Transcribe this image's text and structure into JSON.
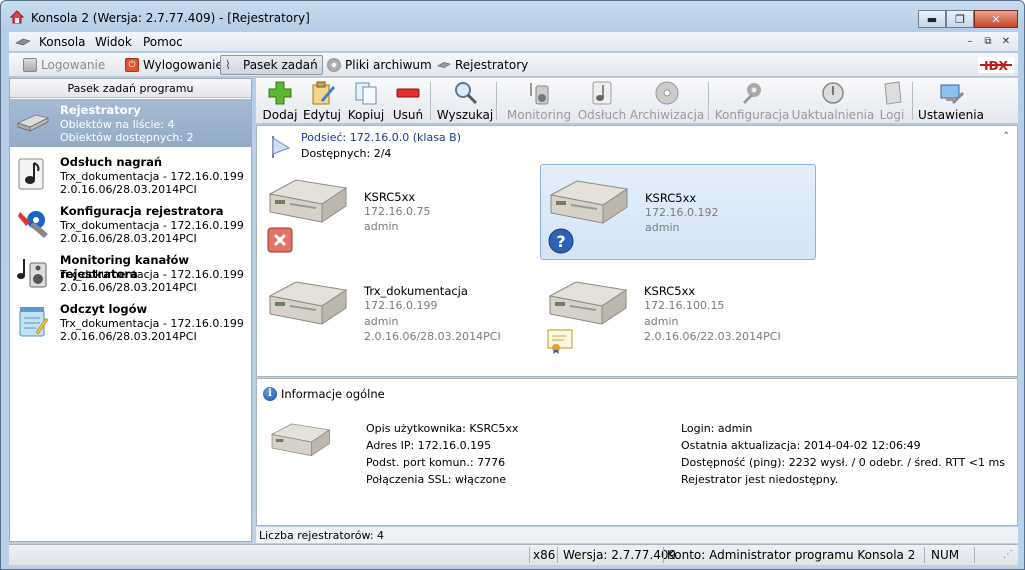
{
  "window": {
    "title": "Konsola 2 (Wersja:  2.7.77.409) - [Rejestratory]",
    "minimize": "▬",
    "maximize": "❐",
    "close": "✕"
  },
  "menu": {
    "items": [
      "Konsola",
      "Widok",
      "Pomoc"
    ],
    "mdi": [
      "–",
      "⧉",
      "✕"
    ]
  },
  "taskbar": {
    "items": [
      {
        "label": "Logowanie",
        "state": "disabled"
      },
      {
        "label": "Wylogowanie",
        "state": "normal"
      },
      {
        "label": "Pasek zadań",
        "state": "active"
      },
      {
        "label": "Pliki archiwum",
        "state": "normal"
      },
      {
        "label": "Rejestratory",
        "state": "normal"
      }
    ]
  },
  "sidebar": {
    "header": "Pasek zadań programu",
    "items": [
      {
        "title": "Rejestratory",
        "line1": "Obiektów na liście: 4",
        "line2": "Obiektów dostępnych: 2",
        "selected": true,
        "icon": "recorder-icon"
      },
      {
        "title": "Odsłuch nagrań",
        "line1": "Trx_dokumentacja - 172.16.0.199",
        "line2": "2.0.16.06/28.03.2014PCI",
        "icon": "music-note-icon"
      },
      {
        "title": "Konfiguracja rejestratora",
        "line1": "Trx_dokumentacja - 172.16.0.199",
        "line2": "2.0.16.06/28.03.2014PCI",
        "icon": "tools-icon"
      },
      {
        "title": "Monitoring kanałów rejestratora",
        "line1": "Trx_dokumentacja - 172.16.0.199",
        "line2": "2.0.16.06/28.03.2014PCI",
        "icon": "speaker-icon"
      },
      {
        "title": "Odczyt logów",
        "line1": "Trx_dokumentacja - 172.16.0.199",
        "line2": "2.0.16.06/28.03.2014PCI",
        "icon": "notepad-icon"
      }
    ]
  },
  "toolbar": {
    "items": [
      {
        "label": "Dodaj",
        "icon": "add-icon",
        "enabled": true
      },
      {
        "label": "Edytuj",
        "icon": "edit-icon",
        "enabled": true
      },
      {
        "label": "Kopiuj",
        "icon": "copy-icon",
        "enabled": true
      },
      {
        "label": "Usuń",
        "icon": "delete-icon",
        "enabled": true
      },
      {
        "label": "Wyszukaj",
        "icon": "search-icon",
        "enabled": true
      },
      {
        "label": "Monitoring",
        "icon": "monitoring-icon",
        "enabled": false
      },
      {
        "label": "Odsłuch",
        "icon": "listen-icon",
        "enabled": false
      },
      {
        "label": "Archiwizacja",
        "icon": "archive-icon",
        "enabled": false
      },
      {
        "label": "Konfiguracja",
        "icon": "config-icon",
        "enabled": false
      },
      {
        "label": "Uaktualnienia",
        "icon": "update-icon",
        "enabled": false
      },
      {
        "label": "Logi",
        "icon": "logs-icon",
        "enabled": false
      },
      {
        "label": "Ustawienia",
        "icon": "settings-icon",
        "enabled": true
      }
    ]
  },
  "devices": {
    "subnet_title": "Podsieć: 172.16.0.0 (klasa B)",
    "available": "Dostępnych: 2/4",
    "collapse": "˄",
    "list": [
      {
        "name": "KSRC5xx",
        "ip": "172.16.0.75",
        "user": "admin",
        "version": "",
        "badge": "error-badge-icon",
        "selected": false
      },
      {
        "name": "KSRC5xx",
        "ip": "172.16.0.192",
        "user": "admin",
        "version": "",
        "badge": "question-badge-icon",
        "selected": true
      },
      {
        "name": "Trx_dokumentacja",
        "ip": "172.16.0.199",
        "user": "admin",
        "version": "2.0.16.06/28.03.2014PCI",
        "badge": "",
        "selected": false
      },
      {
        "name": "KSRC5xx",
        "ip": "172.16.100.15",
        "user": "admin",
        "version": "2.0.16.06/22.03.2014PCI",
        "badge": "certificate-badge-icon",
        "selected": false
      }
    ]
  },
  "info": {
    "title": "Informacje ogólne",
    "icon_letter": "i",
    "left": [
      "Opis użytkownika: KSRC5xx",
      "Adres IP: 172.16.0.195",
      "Podst. port komun.: 7776",
      "Połączenia SSL: włączone"
    ],
    "right": [
      "Login: admin",
      "Ostatnia aktualizacja: 2014-04-02 12:06:49",
      "Dostępność (ping): 2232 wysł. / 0 odebr. / śred. RTT <1 ms",
      "Rejestrator jest niedostępny."
    ]
  },
  "count_label": "Liczba rejestratorów: 4",
  "status": {
    "arch": "x86",
    "version": "Wersja: 2.7.77.409",
    "account": "Konto: Administrator programu Konsola 2",
    "num": "NUM"
  },
  "brand_logo": "IDX"
}
